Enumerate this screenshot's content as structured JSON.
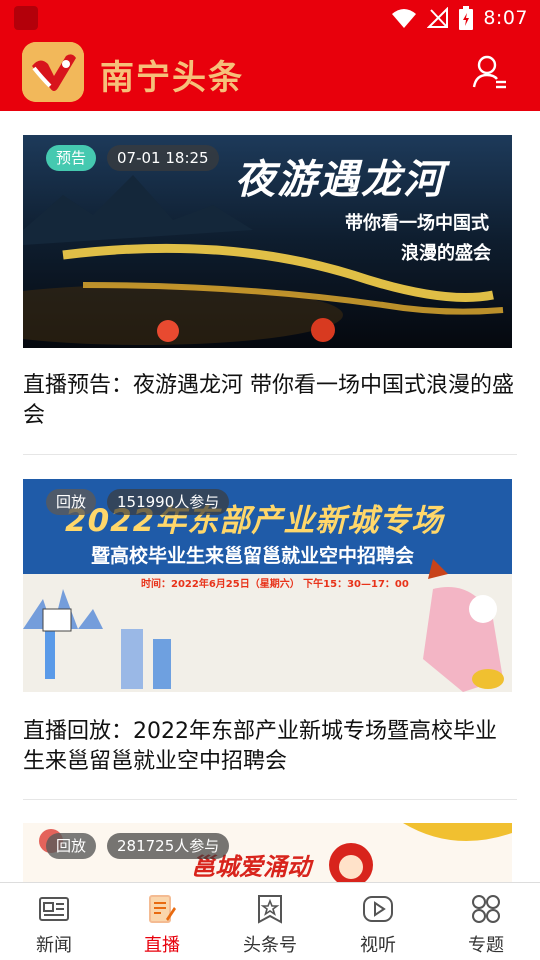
{
  "status_bar": {
    "time": "8:07"
  },
  "header": {
    "app_name": "南宁头条"
  },
  "colors": {
    "brand_red": "#e8000c",
    "title_gold": "#f6c07a",
    "preview_badge": "#45c9b0",
    "active_tab": "#e8000c"
  },
  "feed": {
    "items": [
      {
        "status": "预告",
        "meta": "07-01 18:25",
        "image_text": {
          "headline": "夜游遇龙河",
          "subline1": "带你看一场中国式",
          "subline2": "浪漫的盛会"
        },
        "title": "直播预告：夜游遇龙河 带你看一场中国式浪漫的盛会"
      },
      {
        "status": "回放",
        "meta": "151990人参与",
        "image_text": {
          "headline": "2022年东部产业新城专场",
          "subline1": "暨高校毕业生来邕留邕就业空中招聘会",
          "time_line": "时间：2022年6月25日（星期六） 下午15：30—17：00"
        },
        "title": "直播回放：2022年东部产业新城专场暨高校毕业生来邕留邕就业空中招聘会"
      },
      {
        "status": "回放",
        "meta": "281725人参与",
        "image_text": {
          "headline": "邕城爱涌动"
        },
        "title": ""
      }
    ]
  },
  "tabbar": {
    "tabs": [
      {
        "label": "新闻",
        "icon": "newspaper-icon",
        "active": false
      },
      {
        "label": "直播",
        "icon": "live-document-icon",
        "active": true
      },
      {
        "label": "头条号",
        "icon": "star-bookmark-icon",
        "active": false
      },
      {
        "label": "视听",
        "icon": "play-icon",
        "active": false
      },
      {
        "label": "专题",
        "icon": "grid-icon",
        "active": false
      }
    ]
  }
}
